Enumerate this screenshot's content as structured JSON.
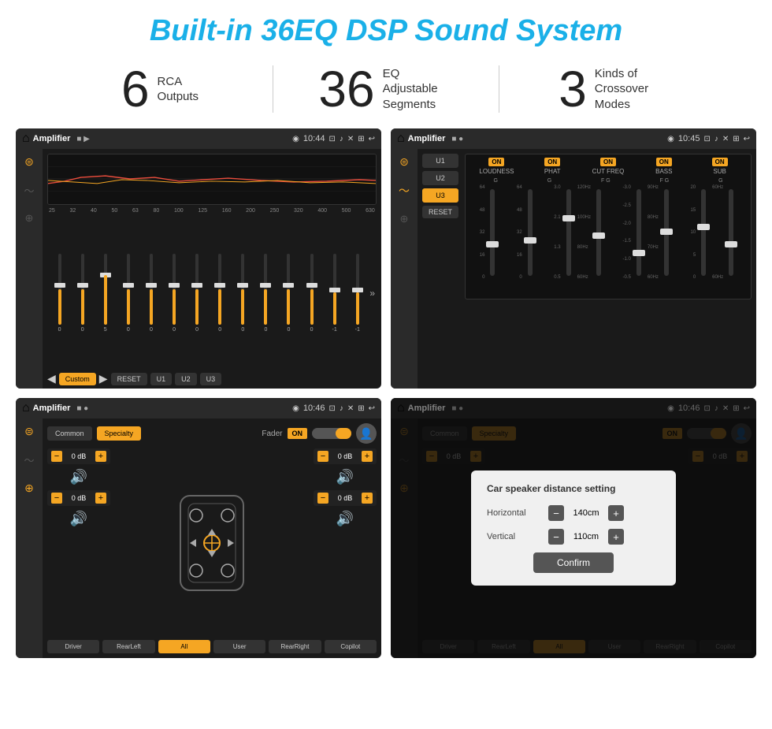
{
  "page": {
    "title": "Built-in 36EQ DSP Sound System"
  },
  "stats": [
    {
      "number": "6",
      "label_line1": "RCA",
      "label_line2": "Outputs"
    },
    {
      "number": "36",
      "label_line1": "EQ Adjustable",
      "label_line2": "Segments"
    },
    {
      "number": "3",
      "label_line1": "Kinds of",
      "label_line2": "Crossover Modes"
    }
  ],
  "screen1": {
    "app_name": "Amplifier",
    "time": "10:44",
    "freq_labels": [
      "25",
      "32",
      "40",
      "50",
      "63",
      "80",
      "100",
      "125",
      "160",
      "200",
      "250",
      "320",
      "400",
      "500",
      "630"
    ],
    "slider_values": [
      "0",
      "0",
      "5",
      "0",
      "0",
      "0",
      "0",
      "0",
      "0",
      "0",
      "0",
      "0",
      "-1",
      "-1"
    ],
    "buttons": [
      "Custom",
      "RESET",
      "U1",
      "U2",
      "U3"
    ]
  },
  "screen2": {
    "app_name": "Amplifier",
    "time": "10:45",
    "u_buttons": [
      "U1",
      "U2",
      "U3"
    ],
    "active_u": "U3",
    "columns": [
      "LOUDNESS",
      "PHAT",
      "CUT FREQ",
      "BASS",
      "SUB"
    ],
    "reset_label": "RESET"
  },
  "screen3": {
    "app_name": "Amplifier",
    "time": "10:46",
    "mode_buttons": [
      "Common",
      "Specialty"
    ],
    "active_mode": "Specialty",
    "fader_label": "Fader",
    "on_label": "ON",
    "vol_values": [
      "0 dB",
      "0 dB",
      "0 dB",
      "0 dB"
    ],
    "bottom_buttons": [
      "Driver",
      "RearLeft",
      "All",
      "User",
      "RearRight",
      "Copilot"
    ],
    "active_bottom": "All"
  },
  "screen4": {
    "app_name": "Amplifier",
    "time": "10:46",
    "mode_buttons": [
      "Common",
      "Specialty"
    ],
    "active_mode": "Specialty",
    "on_label": "ON",
    "dialog": {
      "title": "Car speaker distance setting",
      "horizontal_label": "Horizontal",
      "horizontal_value": "140cm",
      "vertical_label": "Vertical",
      "vertical_value": "110cm",
      "confirm_label": "Confirm"
    },
    "vol_values": [
      "0 dB",
      "0 dB"
    ],
    "bottom_buttons": [
      "Driver",
      "RearLeft",
      "All",
      "User",
      "RearRight",
      "Copilot"
    ]
  },
  "icons": {
    "home": "⌂",
    "back": "↩",
    "menu": "☰",
    "location": "◉",
    "camera": "⊡",
    "volume": "♪",
    "close_x": "✕",
    "window": "⊞",
    "eq_icon": "⚡",
    "wave_icon": "〜",
    "split_icon": "⊕",
    "filter_icon": "⊜",
    "person_icon": "👤"
  }
}
